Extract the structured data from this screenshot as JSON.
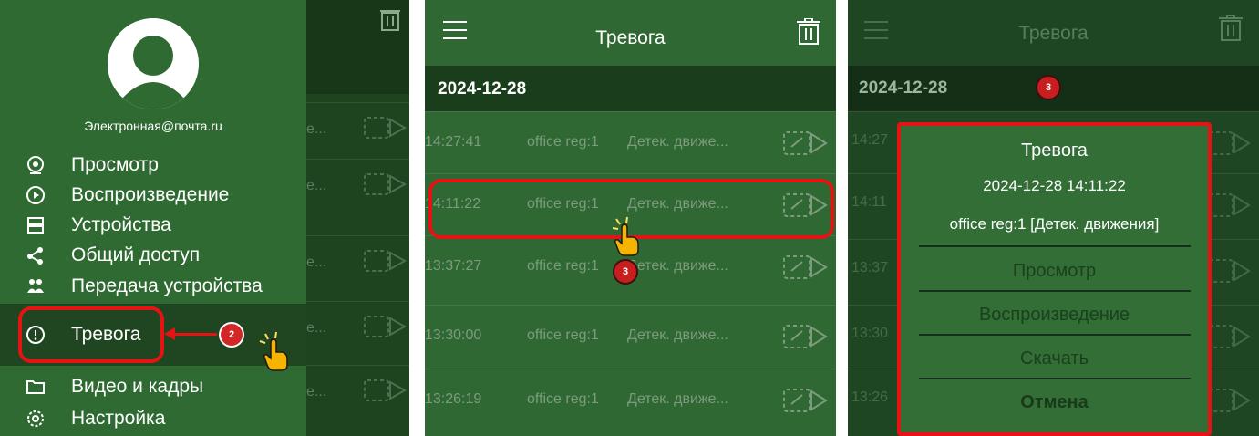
{
  "panel1": {
    "email": "Электронная@почта.ru",
    "menu": [
      {
        "label": "Просмотр",
        "icon": "camera-icon"
      },
      {
        "label": "Воспроизведение",
        "icon": "play-icon"
      },
      {
        "label": "Устройства",
        "icon": "devices-icon"
      },
      {
        "label": "Общий доступ",
        "icon": "share-icon"
      },
      {
        "label": "Передача устройства",
        "icon": "transfer-icon"
      },
      {
        "label": "Тревога",
        "icon": "alarm-icon",
        "selected": true
      },
      {
        "label": "Видео и кадры",
        "icon": "folder-icon"
      },
      {
        "label": "Настройка",
        "icon": "settings-icon"
      }
    ],
    "background_rows": [
      "e...",
      "e...",
      "e...",
      "e...",
      "e..."
    ],
    "step_badge": "2"
  },
  "panel2": {
    "title": "Тревога",
    "date": "2024-12-28",
    "rows": [
      {
        "time": "14:27:41",
        "device": "office reg:1",
        "event": "Детек. движе..."
      },
      {
        "time": "14:11:22",
        "device": "office reg:1",
        "event": "Детек. движе..."
      },
      {
        "time": "13:37:27",
        "device": "office reg:1",
        "event": "Детек. движе..."
      },
      {
        "time": "13:30:00",
        "device": "office reg:1",
        "event": "Детек. движе..."
      },
      {
        "time": "13:26:19",
        "device": "office reg:1",
        "event": "Детек. движе..."
      }
    ],
    "step_badge": "3"
  },
  "panel3": {
    "title": "Тревога",
    "date": "2024-12-28",
    "rows": [
      "14:27",
      "14:11",
      "13:37",
      "13:30",
      "13:26"
    ],
    "step_badge": "3",
    "dialog": {
      "title": "Тревога",
      "datetime": "2024-12-28 14:11:22",
      "info": "office reg:1 [Детек. движения]",
      "buttons": [
        "Просмотр",
        "Воспроизведение",
        "Скачать"
      ],
      "cancel": "Отмена"
    }
  },
  "colors": {
    "accent_red": "#e51313",
    "drawer_green": "#2f6a32",
    "list_green": "#2f6832"
  }
}
